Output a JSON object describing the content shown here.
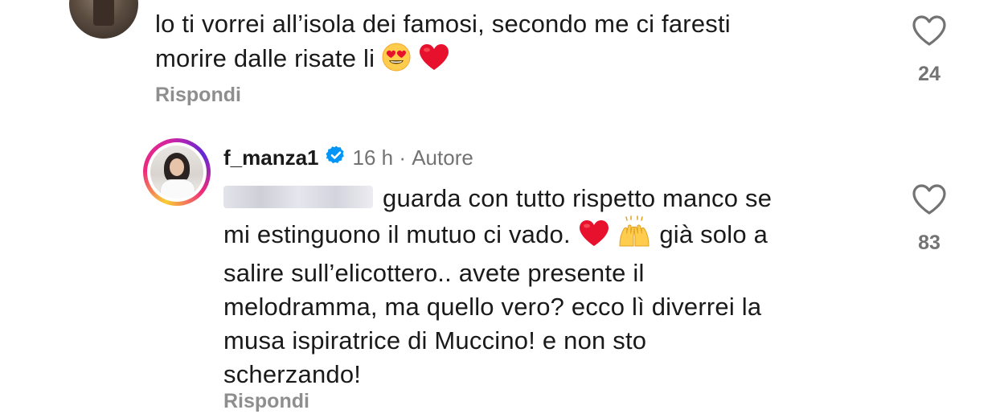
{
  "comment_top": {
    "text_line1": "lo ti vorrei all’isola dei famosi, secondo me ci faresti",
    "text_line2": "morire dalle risate li",
    "emoji1": "heart-eyes-emoji",
    "emoji2": "red-heart-emoji",
    "reply_label": "Rispondi",
    "likes": "24"
  },
  "comment_reply": {
    "username": "f_manza1",
    "verified_icon": "verified-badge-icon",
    "time": "16 h",
    "separator": " · ",
    "role": "Autore",
    "text_part1": "guarda con tutto rispetto manco se",
    "text_part2": "mi estinguono il mutuo ci vado.",
    "emoji_heart": "red-heart-emoji",
    "emoji_hands": "raising-hands-emoji",
    "text_part3": "già solo a",
    "text_part4": "salire sull’elicottero.. avete presente il",
    "text_part5": "melodramma, ma quello vero? ecco lì diverrei la",
    "text_part6": "musa ispiratrice di Muccino! e non sto",
    "text_part7": "scherzando!",
    "reply_label": "Rispondi",
    "likes": "83"
  },
  "colors": {
    "text": "#1a1a1a",
    "muted": "#737373",
    "reply": "#8e8e8e",
    "verified": "#0095f6",
    "heart": "#e8112d"
  }
}
